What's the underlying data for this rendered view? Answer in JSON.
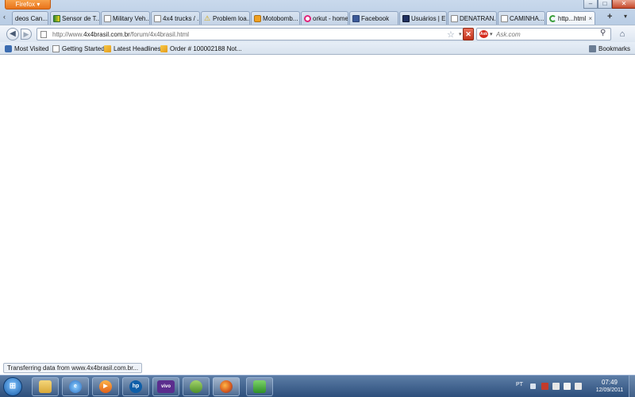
{
  "window": {
    "app_button": "Firefox ▾",
    "min_glyph": "–",
    "max_glyph": "□",
    "close_glyph": "✕"
  },
  "tabs": [
    {
      "label": "deos Can...",
      "icon": "page-icon"
    },
    {
      "label": "Sensor de T...",
      "icon": "flag-icon"
    },
    {
      "label": "Military Veh...",
      "icon": "page-icon"
    },
    {
      "label": "4x4 trucks / ...",
      "icon": "page-icon"
    },
    {
      "label": "Problem loa...",
      "icon": "warning-icon"
    },
    {
      "label": "Motobomb...",
      "icon": "motobomba-icon"
    },
    {
      "label": "orkut - home",
      "icon": "orkut-icon"
    },
    {
      "label": "Facebook",
      "icon": "facebook-icon"
    },
    {
      "label": "Usuários | E...",
      "icon": "site-icon"
    },
    {
      "label": "DENATRAN...",
      "icon": "page-icon"
    },
    {
      "label": "CAMINHA...",
      "icon": "page-icon"
    },
    {
      "label": "http...html",
      "icon": "loading-icon",
      "active": true
    }
  ],
  "tab_controls": {
    "scroll_left": "‹",
    "new_tab": "+",
    "list_all": "▾",
    "close": "×"
  },
  "nav": {
    "back_glyph": "◀",
    "forward_glyph": "▶",
    "url_prefix": "http://www.",
    "url_domain": "4x4brasil.com.br",
    "url_path": "/forum/4x4brasil.html",
    "star_glyph": "☆",
    "dropdown_glyph": "▾",
    "stop_glyph": "✕",
    "search_engine": "Ask",
    "search_placeholder": "Ask.com",
    "search_go_glyph": "⚲",
    "home_glyph": "⌂"
  },
  "bookmarks": {
    "items": [
      {
        "label": "Most Visited",
        "icon": "gear-icon"
      },
      {
        "label": "Getting Started",
        "icon": "page-icon"
      },
      {
        "label": "Latest Headlines",
        "icon": "rss-icon"
      },
      {
        "label": "Order # 100002188 Not...",
        "icon": "rss-icon"
      }
    ],
    "bookmarks_menu": "Bookmarks"
  },
  "status": {
    "text": "Transferring data from www.4x4brasil.com.br..."
  },
  "taskbar": {
    "start_glyph": "⊞",
    "apps": [
      {
        "name": "explorer",
        "glyph": ""
      },
      {
        "name": "internet-explorer",
        "glyph": "e"
      },
      {
        "name": "media-player",
        "glyph": "▶"
      },
      {
        "name": "hp",
        "glyph": "hp"
      },
      {
        "name": "vivo",
        "glyph": "vivo"
      },
      {
        "name": "messenger",
        "glyph": ""
      },
      {
        "name": "firefox",
        "glyph": ""
      },
      {
        "name": "network-app",
        "glyph": ""
      }
    ],
    "tray": {
      "language": "PT",
      "time": "07:49",
      "date": "12/09/2011"
    }
  }
}
